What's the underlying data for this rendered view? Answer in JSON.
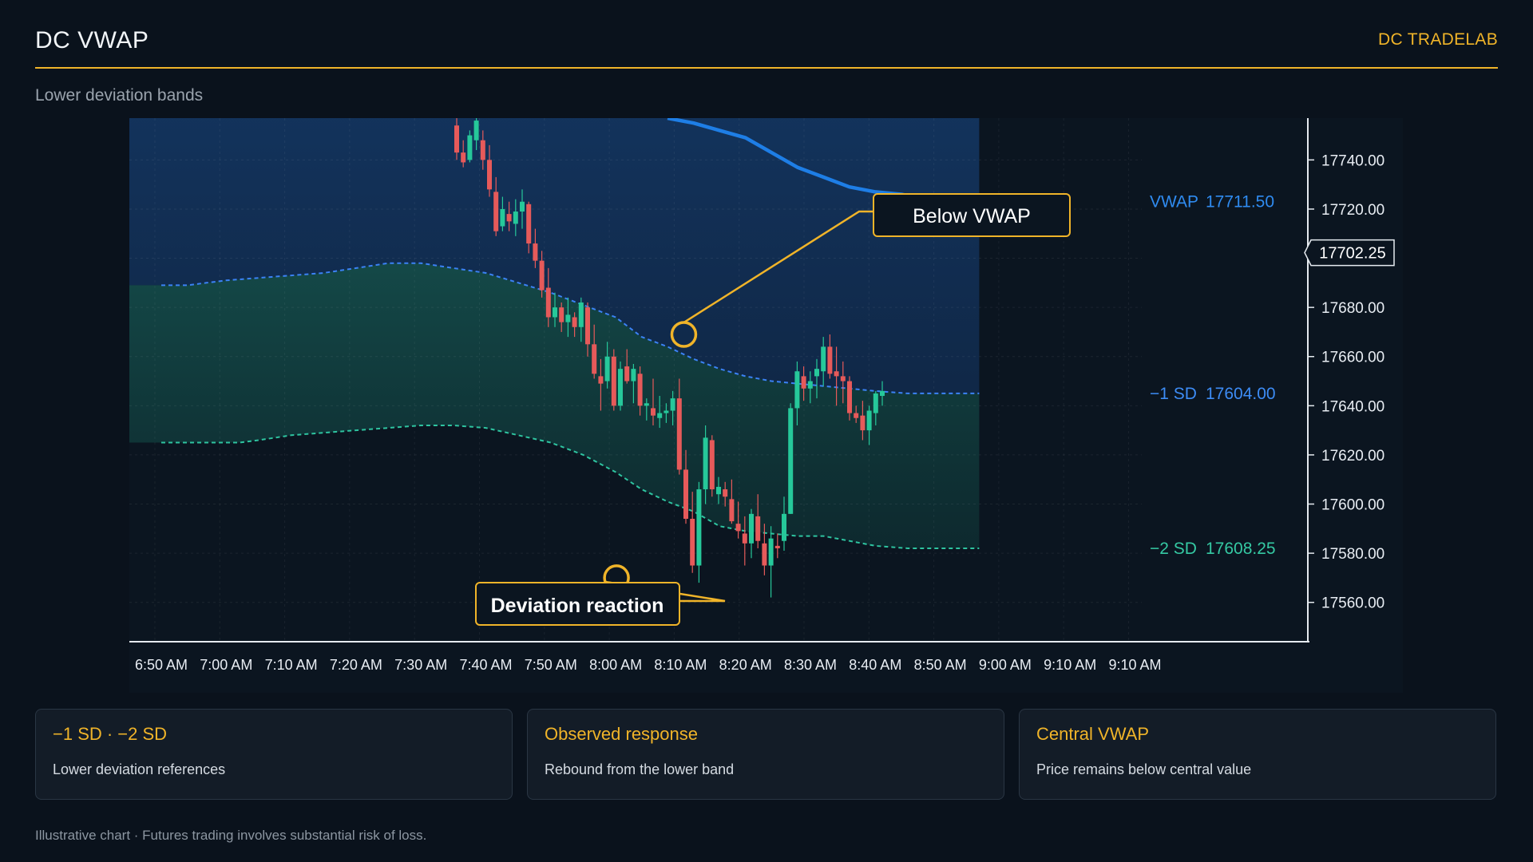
{
  "header": {
    "title": "DC VWAP",
    "brand": "DC TRADELAB"
  },
  "subtitle": "Lower deviation bands",
  "colors": {
    "accent": "#f0b429",
    "vwap": "#1e7ee6",
    "sd1": "#3b82f6",
    "sd2": "#2ec4a0",
    "bull": "#26c89a",
    "bear": "#e65a5a"
  },
  "chart_data": {
    "type": "candlestick",
    "x_tick_labels": [
      "6:50 AM",
      "7:00 AM",
      "7:10 AM",
      "7:20 AM",
      "7:30 AM",
      "7:40 AM",
      "7:50 AM",
      "8:00 AM",
      "8:10 AM",
      "8:20 AM",
      "8:30 AM",
      "8:40 AM",
      "8:50 AM",
      "9:00 AM",
      "9:10 AM",
      "9:10 AM"
    ],
    "y_ticks": [
      17740,
      17720,
      17700,
      17680,
      17660,
      17640,
      17620,
      17600,
      17580,
      17560
    ],
    "y_tick_labels": [
      "17740.00",
      "17720.00",
      "17700.00",
      "17680.00",
      "17660.00",
      "17640.00",
      "17620.00",
      "17600.00",
      "17580.00",
      "17560.00"
    ],
    "ylim": [
      17544,
      17757
    ],
    "current_price_label": "17702.25",
    "current_price": 17702.25,
    "lines": [
      {
        "label": "VWAP",
        "value_label": "17711.50",
        "style": "solid",
        "color": "#1e7ee6",
        "points": [
          [
            7.8,
            17757
          ],
          [
            8.2,
            17755
          ],
          [
            8.6,
            17752
          ],
          [
            9.0,
            17749
          ],
          [
            9.4,
            17743
          ],
          [
            9.8,
            17737
          ],
          [
            10.2,
            17733
          ],
          [
            10.6,
            17729
          ],
          [
            11.0,
            17727
          ],
          [
            11.4,
            17726
          ],
          [
            11.8,
            17724
          ],
          [
            12.2,
            17723
          ],
          [
            12.6,
            17723
          ]
        ]
      },
      {
        "label": "−1 SD",
        "value_label": "17604.00",
        "style": "dashed",
        "color": "#3b82f6",
        "points": [
          [
            0,
            17689
          ],
          [
            0.4,
            17689
          ],
          [
            0.7,
            17690
          ],
          [
            1.0,
            17691
          ],
          [
            1.5,
            17692
          ],
          [
            2.0,
            17693
          ],
          [
            2.5,
            17694
          ],
          [
            3.0,
            17696
          ],
          [
            3.5,
            17698
          ],
          [
            4.0,
            17698
          ],
          [
            4.5,
            17696
          ],
          [
            5.0,
            17694
          ],
          [
            5.5,
            17690
          ],
          [
            6.0,
            17686
          ],
          [
            6.5,
            17681
          ],
          [
            7.0,
            17676
          ],
          [
            7.4,
            17668
          ],
          [
            7.8,
            17664
          ],
          [
            8.2,
            17659
          ],
          [
            8.6,
            17655
          ],
          [
            9.0,
            17652
          ],
          [
            9.4,
            17650
          ],
          [
            9.8,
            17649
          ],
          [
            10.2,
            17648
          ],
          [
            10.6,
            17647
          ],
          [
            11.0,
            17646
          ],
          [
            11.5,
            17645
          ],
          [
            12.0,
            17645
          ],
          [
            12.6,
            17645
          ]
        ]
      },
      {
        "label": "−2 SD",
        "value_label": "17608.25",
        "style": "dashed",
        "color": "#2ec4a0",
        "points": [
          [
            0,
            17625
          ],
          [
            0.4,
            17625
          ],
          [
            0.8,
            17625
          ],
          [
            1.0,
            17625
          ],
          [
            1.2,
            17625
          ],
          [
            1.5,
            17626
          ],
          [
            2.0,
            17628
          ],
          [
            2.5,
            17629
          ],
          [
            3.0,
            17630
          ],
          [
            3.5,
            17631
          ],
          [
            4.0,
            17632
          ],
          [
            4.5,
            17632
          ],
          [
            5.0,
            17631
          ],
          [
            5.5,
            17628
          ],
          [
            6.0,
            17625
          ],
          [
            6.5,
            17620
          ],
          [
            7.0,
            17613
          ],
          [
            7.4,
            17606
          ],
          [
            7.8,
            17601
          ],
          [
            8.2,
            17597
          ],
          [
            8.6,
            17591
          ],
          [
            9.0,
            17589
          ],
          [
            9.4,
            17588
          ],
          [
            9.8,
            17587
          ],
          [
            10.2,
            17587
          ],
          [
            10.6,
            17585
          ],
          [
            11.0,
            17583
          ],
          [
            11.5,
            17582
          ],
          [
            12.0,
            17582
          ],
          [
            12.6,
            17582
          ]
        ]
      }
    ],
    "candles": [
      [
        17754,
        17757,
        17740,
        17743
      ],
      [
        17743,
        17748,
        17737,
        17739
      ],
      [
        17740,
        17752,
        17739,
        17750
      ],
      [
        17748,
        17757,
        17744,
        17756
      ],
      [
        17748,
        17752,
        17736,
        17740
      ],
      [
        17740,
        17746,
        17725,
        17728
      ],
      [
        17727,
        17733,
        17709,
        17711
      ],
      [
        17713,
        17725,
        17711,
        17720
      ],
      [
        17718,
        17723,
        17711,
        17715
      ],
      [
        17714,
        17724,
        17709,
        17719
      ],
      [
        17719,
        17728,
        17712,
        17723
      ],
      [
        17722,
        17723,
        17702,
        17706
      ],
      [
        17706,
        17712,
        17696,
        17699
      ],
      [
        17699,
        17703,
        17684,
        17687
      ],
      [
        17688,
        17696,
        17672,
        17676
      ],
      [
        17676,
        17686,
        17672,
        17680
      ],
      [
        17680,
        17682,
        17670,
        17674
      ],
      [
        17674,
        17684,
        17668,
        17677
      ],
      [
        17676,
        17678,
        17668,
        17672
      ],
      [
        17672,
        17684,
        17666,
        17682
      ],
      [
        17680,
        17682,
        17660,
        17665
      ],
      [
        17665,
        17673,
        17651,
        17653
      ],
      [
        17652,
        17659,
        17638,
        17649
      ],
      [
        17650,
        17666,
        17647,
        17660
      ],
      [
        17660,
        17663,
        17638,
        17640
      ],
      [
        17640,
        17658,
        17638,
        17655
      ],
      [
        17656,
        17663,
        17649,
        17650
      ],
      [
        17650,
        17657,
        17641,
        17655
      ],
      [
        17653,
        17656,
        17636,
        17640
      ],
      [
        17640,
        17643,
        17634,
        17641
      ],
      [
        17639,
        17651,
        17632,
        17636
      ],
      [
        17635,
        17644,
        17631,
        17637
      ],
      [
        17637,
        17641,
        17633,
        17638
      ],
      [
        17638,
        17646,
        17632,
        17643
      ],
      [
        17643,
        17651,
        17612,
        17614
      ],
      [
        17614,
        17622,
        17592,
        17594
      ],
      [
        17594,
        17605,
        17572,
        17575
      ],
      [
        17575,
        17609,
        17568,
        17606
      ],
      [
        17606,
        17632,
        17600,
        17627
      ],
      [
        17626,
        17628,
        17603,
        17606
      ],
      [
        17604,
        17611,
        17600,
        17607
      ],
      [
        17606,
        17609,
        17599,
        17603
      ],
      [
        17602,
        17610,
        17592,
        17593
      ],
      [
        17592,
        17601,
        17586,
        17589
      ],
      [
        17588,
        17595,
        17575,
        17584
      ],
      [
        17584,
        17598,
        17578,
        17596
      ],
      [
        17595,
        17604,
        17582,
        17585
      ],
      [
        17584,
        17592,
        17571,
        17575
      ],
      [
        17575,
        17591,
        17562,
        17586
      ],
      [
        17583,
        17588,
        17578,
        17582
      ],
      [
        17585,
        17603,
        17581,
        17596
      ],
      [
        17596,
        17641,
        17596,
        17639
      ],
      [
        17639,
        17658,
        17632,
        17654
      ],
      [
        17652,
        17656,
        17642,
        17647
      ],
      [
        17647,
        17654,
        17641,
        17650
      ],
      [
        17652,
        17659,
        17643,
        17655
      ],
      [
        17654,
        17668,
        17648,
        17664
      ],
      [
        17664,
        17669,
        17651,
        17653
      ],
      [
        17654,
        17664,
        17640,
        17652
      ],
      [
        17652,
        17658,
        17641,
        17650
      ],
      [
        17650,
        17652,
        17634,
        17637
      ],
      [
        17637,
        17640,
        17633,
        17635
      ],
      [
        17636,
        17642,
        17626,
        17630
      ],
      [
        17630,
        17640,
        17624,
        17638
      ],
      [
        17637,
        17646,
        17632,
        17645
      ],
      [
        17644,
        17650,
        17640,
        17646
      ]
    ],
    "annotations": [
      {
        "text": "Below VWAP",
        "x": 8.05,
        "y": 17669
      },
      {
        "text": "Deviation reaction",
        "x": 7.0,
        "y": 17570
      }
    ]
  },
  "cards": [
    {
      "title": "−1 SD · −2 SD",
      "text": "Lower deviation references"
    },
    {
      "title": "Observed response",
      "text": "Rebound from the lower band"
    },
    {
      "title": "Central VWAP",
      "text": "Price remains below central value"
    }
  ],
  "disclaimer": "Illustrative chart · Futures trading involves substantial risk of loss."
}
